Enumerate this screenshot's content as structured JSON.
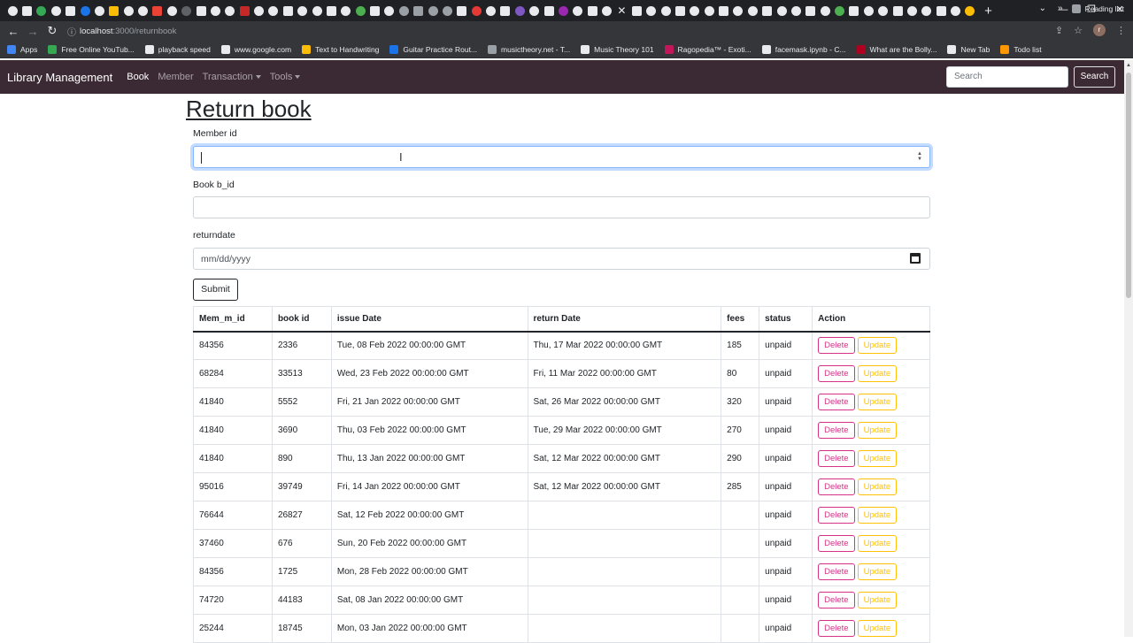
{
  "browser": {
    "url_host": "localhost",
    "url_path": ":3000/returnbook",
    "bookmarks": [
      {
        "label": "Apps",
        "color": "#4285f4"
      },
      {
        "label": "Free Online YouTub...",
        "color": "#34a853"
      },
      {
        "label": "playback speed",
        "color": "#e8eaed"
      },
      {
        "label": "www.google.com",
        "color": "#e8eaed"
      },
      {
        "label": "Text to Handwriting",
        "color": "#fbbc05"
      },
      {
        "label": "Guitar Practice Rout...",
        "color": "#1a73e8"
      },
      {
        "label": "musictheory.net - T...",
        "color": "#9aa0a6"
      },
      {
        "label": "Music Theory 101",
        "color": "#e8eaed"
      },
      {
        "label": "Ragopedia™ - Exoti...",
        "color": "#c2185b"
      },
      {
        "label": "facemask.ipynb - C...",
        "color": "#e8eaed"
      },
      {
        "label": "What are the Bolly...",
        "color": "#b00020"
      },
      {
        "label": "New Tab",
        "color": "#e8eaed"
      },
      {
        "label": "Todo list",
        "color": "#ff9800"
      }
    ],
    "reading_list": "Reading list",
    "avatar_letter": "r"
  },
  "navbar": {
    "brand": "Library Management",
    "links": [
      "Book",
      "Member",
      "Transaction",
      "Tools"
    ],
    "search_placeholder": "Search",
    "search_button": "Search"
  },
  "form": {
    "title": "Return book",
    "member_label": "Member id",
    "book_label": "Book b_id",
    "date_label": "returndate",
    "date_placeholder": "mm/dd/yyyy",
    "submit": "Submit"
  },
  "table": {
    "headers": [
      "Mem_m_id",
      "book id",
      "issue Date",
      "return Date",
      "fees",
      "status",
      "Action"
    ],
    "delete_label": "Delete",
    "update_label": "Update",
    "rows": [
      [
        "84356",
        "2336",
        "Tue, 08 Feb 2022 00:00:00 GMT",
        "Thu, 17 Mar 2022 00:00:00 GMT",
        "185",
        "unpaid"
      ],
      [
        "68284",
        "33513",
        "Wed, 23 Feb 2022 00:00:00 GMT",
        "Fri, 11 Mar 2022 00:00:00 GMT",
        "80",
        "unpaid"
      ],
      [
        "41840",
        "5552",
        "Fri, 21 Jan 2022 00:00:00 GMT",
        "Sat, 26 Mar 2022 00:00:00 GMT",
        "320",
        "unpaid"
      ],
      [
        "41840",
        "3690",
        "Thu, 03 Feb 2022 00:00:00 GMT",
        "Tue, 29 Mar 2022 00:00:00 GMT",
        "270",
        "unpaid"
      ],
      [
        "41840",
        "890",
        "Thu, 13 Jan 2022 00:00:00 GMT",
        "Sat, 12 Mar 2022 00:00:00 GMT",
        "290",
        "unpaid"
      ],
      [
        "95016",
        "39749",
        "Fri, 14 Jan 2022 00:00:00 GMT",
        "Sat, 12 Mar 2022 00:00:00 GMT",
        "285",
        "unpaid"
      ],
      [
        "76644",
        "26827",
        "Sat, 12 Feb 2022 00:00:00 GMT",
        "",
        "",
        "unpaid"
      ],
      [
        "37460",
        "676",
        "Sun, 20 Feb 2022 00:00:00 GMT",
        "",
        "",
        "unpaid"
      ],
      [
        "84356",
        "1725",
        "Mon, 28 Feb 2022 00:00:00 GMT",
        "",
        "",
        "unpaid"
      ],
      [
        "74720",
        "44183",
        "Sat, 08 Jan 2022 00:00:00 GMT",
        "",
        "",
        "unpaid"
      ],
      [
        "25244",
        "18745",
        "Mon, 03 Jan 2022 00:00:00 GMT",
        "",
        "",
        "unpaid"
      ]
    ]
  },
  "colors": {
    "navbar_bg": "#3b2a33",
    "delete": "#d63384",
    "update": "#ffc107",
    "chrome_bg": "#202124"
  }
}
